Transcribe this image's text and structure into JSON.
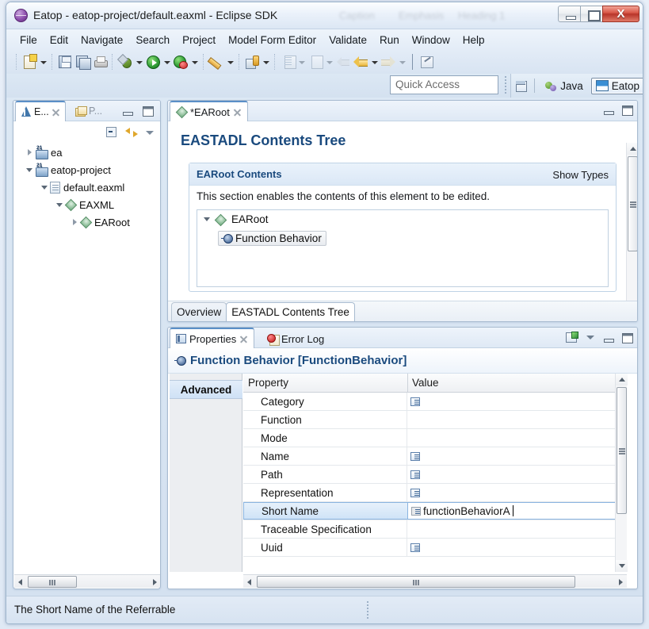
{
  "window": {
    "title": "Eatop - eatop-project/default.eaxml - Eclipse SDK",
    "app_icon": "eclipse-icon",
    "minimize_label": "",
    "maximize_label": "",
    "close_label": "X",
    "ghost_labels": [
      "Caption",
      "Emphasis",
      "Heading 1"
    ]
  },
  "menubar": {
    "items": [
      {
        "label": "File"
      },
      {
        "label": "Edit"
      },
      {
        "label": "Navigate"
      },
      {
        "label": "Search"
      },
      {
        "label": "Project"
      },
      {
        "label": "Model Form Editor"
      },
      {
        "label": "Validate"
      },
      {
        "label": "Run"
      },
      {
        "label": "Window"
      },
      {
        "label": "Help"
      }
    ]
  },
  "toolbar": {
    "icons": [
      {
        "name": "new-icon"
      },
      {
        "name": "save-icon"
      },
      {
        "name": "save-all-icon"
      },
      {
        "name": "print-icon"
      },
      {
        "name": "debug-icon"
      },
      {
        "name": "run-icon"
      },
      {
        "name": "run-external-icon"
      },
      {
        "name": "pen-icon"
      },
      {
        "name": "build-icon"
      },
      {
        "name": "extract-icon"
      },
      {
        "name": "extract-alt-icon"
      },
      {
        "name": "back-disabled-icon"
      },
      {
        "name": "back-icon"
      },
      {
        "name": "forward-icon"
      },
      {
        "name": "annotate-icon"
      }
    ]
  },
  "quick_access": {
    "placeholder": "Quick Access",
    "value": ""
  },
  "perspective": {
    "open_perspective_icon": "open-perspective-icon",
    "items": [
      {
        "label": "Java",
        "icon": "java-perspective-icon",
        "active": false
      },
      {
        "label": "Eatop",
        "icon": "eatop-perspective-icon",
        "active": true
      }
    ]
  },
  "left_view": {
    "tabs": [
      {
        "label": "E...",
        "icon": "eastadl-explorer-icon",
        "active": true,
        "closable": true
      },
      {
        "label": "P...",
        "icon": "package-explorer-icon",
        "active": false,
        "closable": false
      }
    ],
    "view_tools": [
      {
        "name": "collapse-all-icon"
      },
      {
        "name": "link-with-editor-icon"
      },
      {
        "name": "view-menu-icon"
      }
    ],
    "window_controls": [
      {
        "name": "minimize-icon"
      },
      {
        "name": "maximize-icon"
      }
    ],
    "tree": [
      {
        "label": "ea",
        "indent": 0,
        "twist": "closed",
        "icon": "project-icon"
      },
      {
        "label": "eatop-project",
        "indent": 0,
        "twist": "open",
        "icon": "project-icon"
      },
      {
        "label": "default.eaxml",
        "indent": 1,
        "twist": "open",
        "icon": "file-icon"
      },
      {
        "label": "EAXML",
        "indent": 2,
        "twist": "open",
        "icon": "diamond-icon"
      },
      {
        "label": "EARoot",
        "indent": 3,
        "twist": "closed",
        "icon": "diamond-icon"
      }
    ]
  },
  "editor": {
    "tab": {
      "label": "*EARoot",
      "icon": "diamond-icon",
      "closable": true
    },
    "window_controls": [
      {
        "name": "minimize-icon"
      },
      {
        "name": "maximize-icon"
      }
    ],
    "form_title": "EASTADL Contents Tree",
    "section": {
      "title": "EARoot Contents",
      "show_types_label": "Show Types",
      "description": "This section enables the contents of this element to be edited.",
      "tree": [
        {
          "label": "EARoot",
          "indent": 0,
          "twist": "open",
          "icon": "diamond-icon",
          "selected": false
        },
        {
          "label": "Function Behavior",
          "indent": 1,
          "twist": "none",
          "icon": "function-behavior-icon",
          "selected": true
        }
      ]
    },
    "bottom_tabs": [
      {
        "label": "Overview",
        "active": false
      },
      {
        "label": "EASTADL Contents Tree",
        "active": true
      }
    ]
  },
  "properties": {
    "tabs": [
      {
        "label": "Properties",
        "icon": "properties-icon",
        "active": true,
        "closable": true
      },
      {
        "label": "Error Log",
        "icon": "error-log-icon",
        "active": false,
        "closable": false
      }
    ],
    "view_tools": [
      {
        "name": "pin-to-selection-icon"
      },
      {
        "name": "view-menu-icon"
      },
      {
        "name": "minimize-icon"
      },
      {
        "name": "maximize-icon"
      }
    ],
    "header": {
      "icon": "function-behavior-icon",
      "text": "Function Behavior [FunctionBehavior]"
    },
    "side_tabs": [
      {
        "label": "Advanced",
        "active": true
      }
    ],
    "table": {
      "columns": [
        "Property",
        "Value"
      ],
      "rows": [
        {
          "property": "Category",
          "value": "",
          "value_icon": "list-editor-icon",
          "selected": false
        },
        {
          "property": "Function",
          "value": "",
          "value_icon": "",
          "selected": false
        },
        {
          "property": "Mode",
          "value": "",
          "value_icon": "",
          "selected": false
        },
        {
          "property": "Name",
          "value": "",
          "value_icon": "list-editor-icon",
          "selected": false
        },
        {
          "property": "Path",
          "value": "",
          "value_icon": "list-editor-icon",
          "selected": false
        },
        {
          "property": "Representation",
          "value": "",
          "value_icon": "list-editor-icon",
          "selected": false
        },
        {
          "property": "Short Name",
          "value": "functionBehaviorA",
          "value_icon": "list-editor-icon",
          "selected": true,
          "editing": true
        },
        {
          "property": "Traceable Specification",
          "value": "",
          "value_icon": "",
          "selected": false
        },
        {
          "property": "Uuid",
          "value": "",
          "value_icon": "list-editor-icon",
          "selected": false
        }
      ]
    }
  },
  "statusbar": {
    "text": "The Short Name of the Referrable"
  },
  "colors": {
    "accent_blue": "#1a4a7e",
    "selection_blue": "#cfe3f7",
    "tab_active_top": "#5a8fc7",
    "close_button_red": "#b8352a",
    "window_bg": "#dce8f4"
  }
}
